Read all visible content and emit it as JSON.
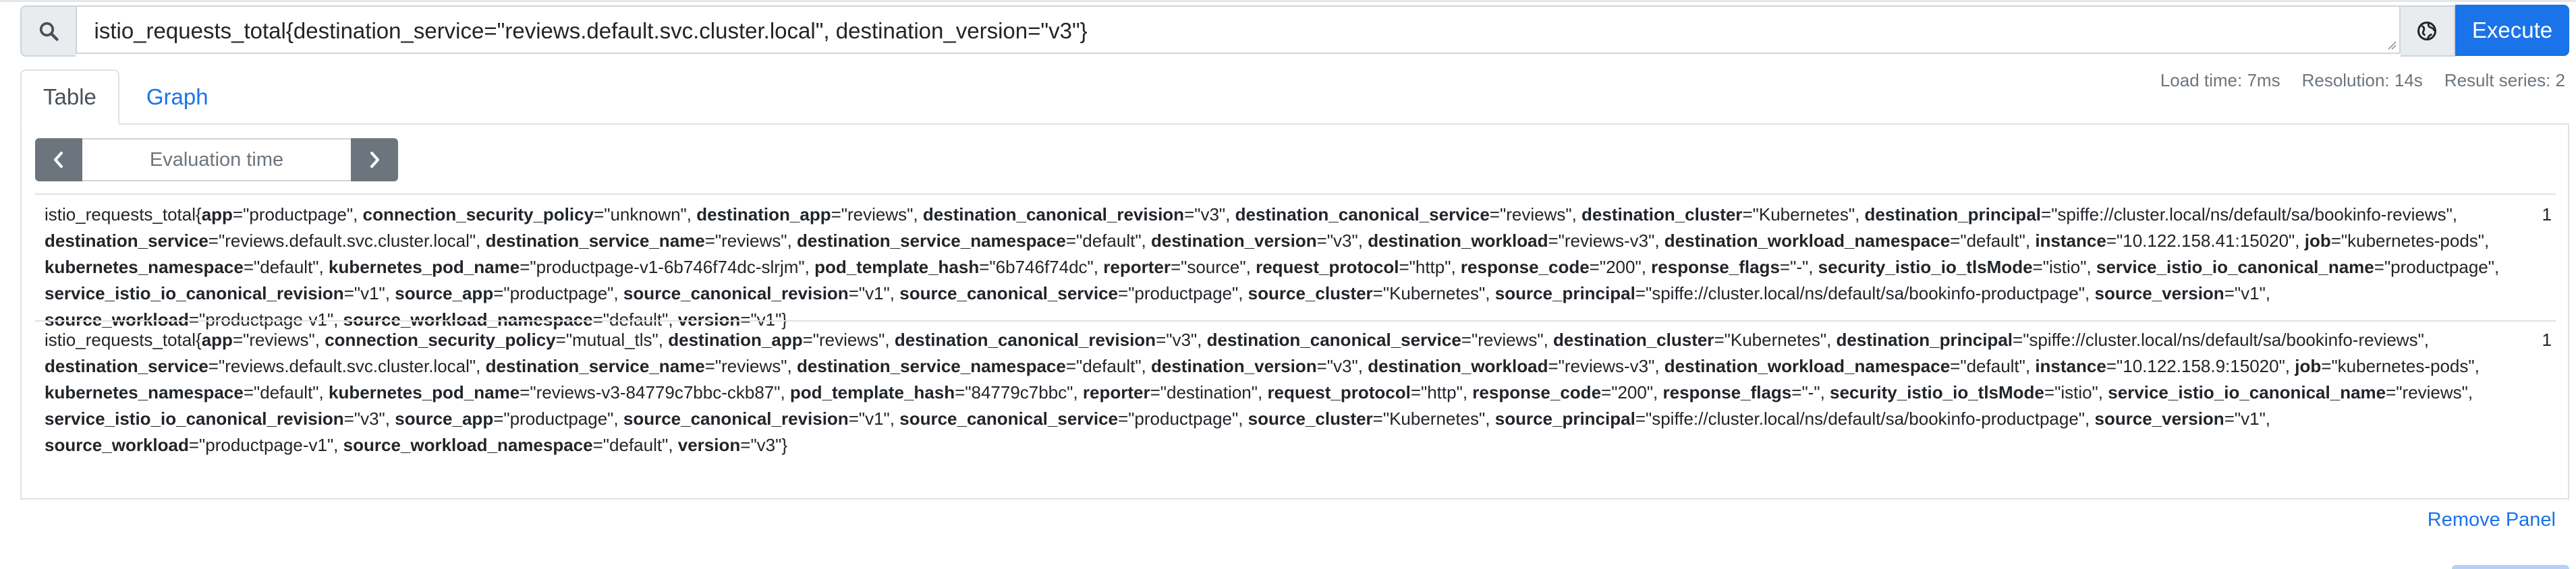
{
  "query": {
    "expression": "istio_requests_total{destination_service=\"reviews.default.svc.cluster.local\", destination_version=\"v3\"}",
    "execute_label": "Execute",
    "search_icon": "search-icon",
    "globe_icon": "globe-icon"
  },
  "tabs": [
    {
      "label": "Table",
      "active": true
    },
    {
      "label": "Graph",
      "active": false
    }
  ],
  "stats": {
    "load_time": "Load time: 7ms",
    "resolution": "Resolution: 14s",
    "result_series": "Result series: 2"
  },
  "eval": {
    "placeholder": "Evaluation time",
    "prev_icon": "chevron-left-icon",
    "next_icon": "chevron-right-icon"
  },
  "results": [
    {
      "metric": "istio_requests_total",
      "value": "1",
      "labels": [
        [
          "app",
          "productpage"
        ],
        [
          "connection_security_policy",
          "unknown"
        ],
        [
          "destination_app",
          "reviews"
        ],
        [
          "destination_canonical_revision",
          "v3"
        ],
        [
          "destination_canonical_service",
          "reviews"
        ],
        [
          "destination_cluster",
          "Kubernetes"
        ],
        [
          "destination_principal",
          "spiffe://cluster.local/ns/default/sa/bookinfo-reviews"
        ],
        [
          "destination_service",
          "reviews.default.svc.cluster.local"
        ],
        [
          "destination_service_name",
          "reviews"
        ],
        [
          "destination_service_namespace",
          "default"
        ],
        [
          "destination_version",
          "v3"
        ],
        [
          "destination_workload",
          "reviews-v3"
        ],
        [
          "destination_workload_namespace",
          "default"
        ],
        [
          "instance",
          "10.122.158.41:15020"
        ],
        [
          "job",
          "kubernetes-pods"
        ],
        [
          "kubernetes_namespace",
          "default"
        ],
        [
          "kubernetes_pod_name",
          "productpage-v1-6b746f74dc-slrjm"
        ],
        [
          "pod_template_hash",
          "6b746f74dc"
        ],
        [
          "reporter",
          "source"
        ],
        [
          "request_protocol",
          "http"
        ],
        [
          "response_code",
          "200"
        ],
        [
          "response_flags",
          "-"
        ],
        [
          "security_istio_io_tlsMode",
          "istio"
        ],
        [
          "service_istio_io_canonical_name",
          "productpage"
        ],
        [
          "service_istio_io_canonical_revision",
          "v1"
        ],
        [
          "source_app",
          "productpage"
        ],
        [
          "source_canonical_revision",
          "v1"
        ],
        [
          "source_canonical_service",
          "productpage"
        ],
        [
          "source_cluster",
          "Kubernetes"
        ],
        [
          "source_principal",
          "spiffe://cluster.local/ns/default/sa/bookinfo-productpage"
        ],
        [
          "source_version",
          "v1"
        ],
        [
          "source_workload",
          "productpage-v1"
        ],
        [
          "source_workload_namespace",
          "default"
        ],
        [
          "version",
          "v1"
        ]
      ]
    },
    {
      "metric": "istio_requests_total",
      "value": "1",
      "labels": [
        [
          "app",
          "reviews"
        ],
        [
          "connection_security_policy",
          "mutual_tls"
        ],
        [
          "destination_app",
          "reviews"
        ],
        [
          "destination_canonical_revision",
          "v3"
        ],
        [
          "destination_canonical_service",
          "reviews"
        ],
        [
          "destination_cluster",
          "Kubernetes"
        ],
        [
          "destination_principal",
          "spiffe://cluster.local/ns/default/sa/bookinfo-reviews"
        ],
        [
          "destination_service",
          "reviews.default.svc.cluster.local"
        ],
        [
          "destination_service_name",
          "reviews"
        ],
        [
          "destination_service_namespace",
          "default"
        ],
        [
          "destination_version",
          "v3"
        ],
        [
          "destination_workload",
          "reviews-v3"
        ],
        [
          "destination_workload_namespace",
          "default"
        ],
        [
          "instance",
          "10.122.158.9:15020"
        ],
        [
          "job",
          "kubernetes-pods"
        ],
        [
          "kubernetes_namespace",
          "default"
        ],
        [
          "kubernetes_pod_name",
          "reviews-v3-84779c7bbc-ckb87"
        ],
        [
          "pod_template_hash",
          "84779c7bbc"
        ],
        [
          "reporter",
          "destination"
        ],
        [
          "request_protocol",
          "http"
        ],
        [
          "response_code",
          "200"
        ],
        [
          "response_flags",
          "-"
        ],
        [
          "security_istio_io_tlsMode",
          "istio"
        ],
        [
          "service_istio_io_canonical_name",
          "reviews"
        ],
        [
          "service_istio_io_canonical_revision",
          "v3"
        ],
        [
          "source_app",
          "productpage"
        ],
        [
          "source_canonical_revision",
          "v1"
        ],
        [
          "source_canonical_service",
          "productpage"
        ],
        [
          "source_cluster",
          "Kubernetes"
        ],
        [
          "source_principal",
          "spiffe://cluster.local/ns/default/sa/bookinfo-productpage"
        ],
        [
          "source_version",
          "v1"
        ],
        [
          "source_workload",
          "productpage-v1"
        ],
        [
          "source_workload_namespace",
          "default"
        ],
        [
          "version",
          "v3"
        ]
      ]
    }
  ],
  "remove_panel_label": "Remove Panel",
  "colors": {
    "accent": "#1a73e8",
    "nav_button": "#6c757d",
    "border": "#dee2e6"
  }
}
